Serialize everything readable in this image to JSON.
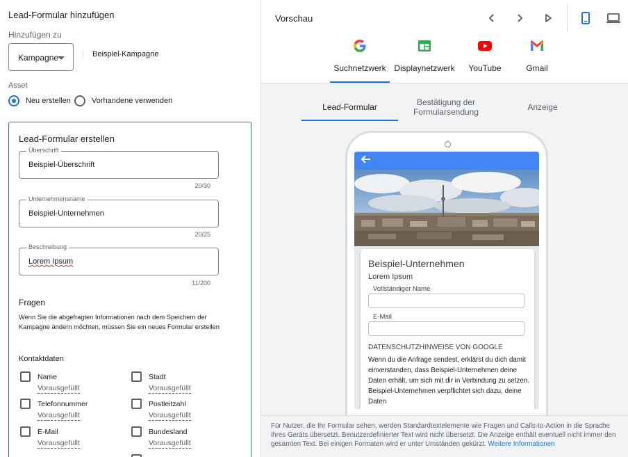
{
  "left": {
    "title": "Lead-Formular hinzufügen",
    "add_to_label": "Hinzufügen zu",
    "dropdown_value": "Kampagne",
    "campaign_name": "Beispiel-Kampagne",
    "asset_label": "Asset",
    "radio_new": "Neu erstellen",
    "radio_existing": "Vorhandene verwenden",
    "form": {
      "title": "Lead-Formular erstellen",
      "fields": [
        {
          "label": "Überschrift",
          "value": "Beispiel-Überschrift",
          "counter": "20/30"
        },
        {
          "label": "Unternehmensname",
          "value": "Beispiel-Unternehmen",
          "counter": "20/25"
        },
        {
          "label": "Beschreibung",
          "value": "Lorem Ipsum",
          "counter": "11/200"
        }
      ],
      "questions_title": "Fragen",
      "questions_help": "Wenn Sie die abgefragten Informationen nach dem Speichern der Kampagne ändern möchten, müssen Sie ein neues Formular erstellen",
      "contact_title": "Kontaktdaten",
      "contacts": [
        {
          "label": "Name",
          "sub": "Vorausgefüllt"
        },
        {
          "label": "Stadt",
          "sub": "Vorausgefüllt"
        },
        {
          "label": "Telefonnummer",
          "sub": "Vorausgefüllt"
        },
        {
          "label": "Postleitzahl",
          "sub": "Vorausgefüllt"
        },
        {
          "label": "E-Mail",
          "sub": "Vorausgefüllt"
        },
        {
          "label": "Bundesland",
          "sub": "Vorausgefüllt"
        }
      ]
    }
  },
  "right": {
    "title": "Vorschau",
    "networks": [
      "Suchnetzwerk",
      "Displaynetzwerk",
      "YouTube",
      "Gmail"
    ],
    "subtabs": [
      "Lead-Formular",
      "Bestätigung der Formularsendung",
      "Anzeige"
    ],
    "preview": {
      "company": "Beispiel-Unternehmen",
      "description": "Lorem Ipsum",
      "field1": "Vollständiger Name",
      "field2": "E-Mail",
      "privacy_title": "DATENSCHUTZHINWEISE VON GOOGLE",
      "privacy_text": "Wenn du die Anfrage sendest, erklärst du dich damit einverstanden, dass Beispiel-Unternehmen deine Daten erhält, um sich mit dir in Verbindung zu setzen. Beispiel-Unternehmen verpflichtet sich dazu, deine Daten"
    },
    "footer_text": "Für Nutzer, die Ihr Formular sehen, werden Standardtextelemente wie Fragen und Calls-to-Action in die Sprache ihres Geräts übersetzt. Benutzerdefinierter Text wird nicht übersetzt. Die Anzeige enthält eventuell nicht immer den gesamten Text. Bei einigen Formaten wird er unter Umständen gekürzt.",
    "footer_link": "Weitere Informationen"
  },
  "colors": {
    "accent": "#1a73e8",
    "appbar": "#4285f4"
  }
}
